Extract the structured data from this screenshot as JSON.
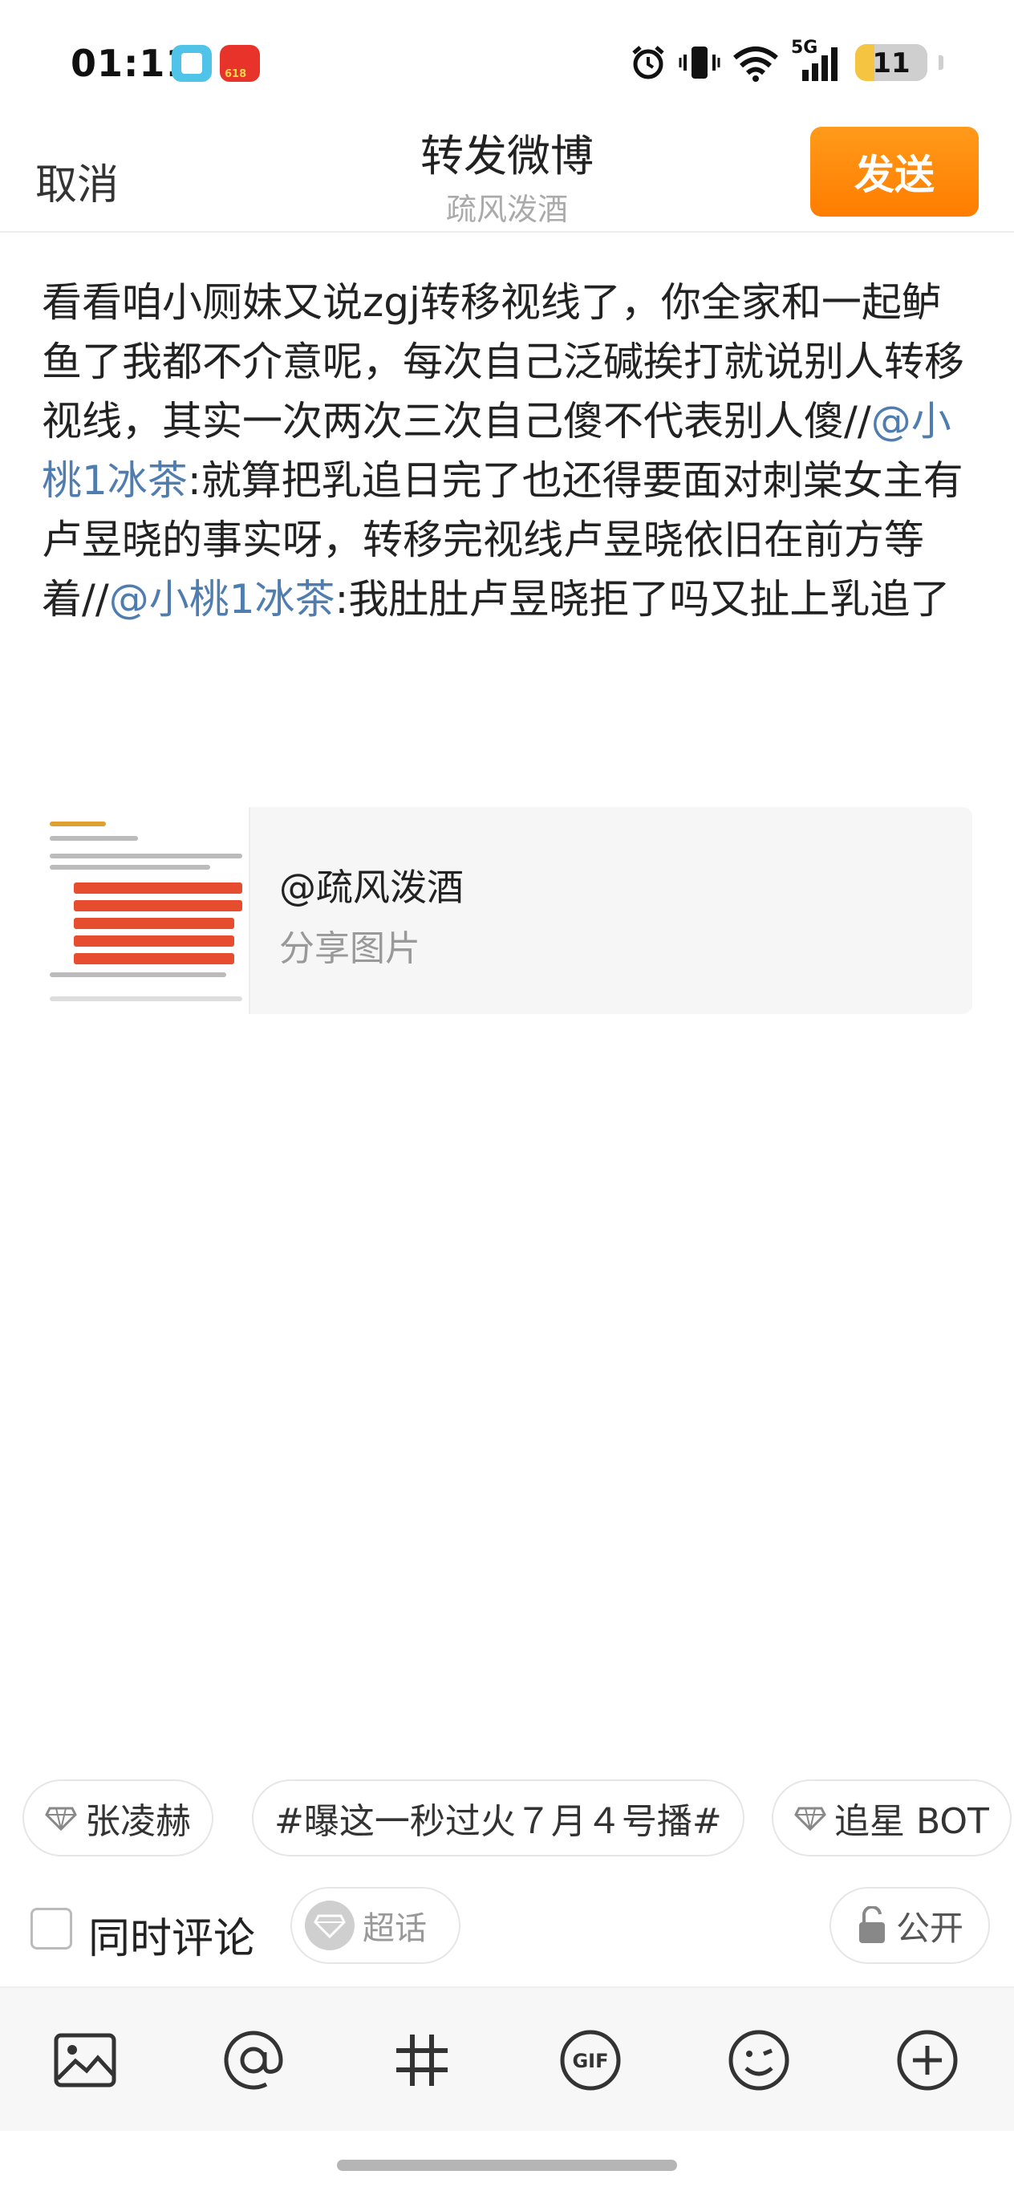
{
  "status_bar": {
    "time": "01:11",
    "network_label": "5G",
    "battery_level": "11"
  },
  "header": {
    "cancel_label": "取消",
    "title": "转发微博",
    "subtitle": "疏风泼酒",
    "send_label": "发送"
  },
  "compose": {
    "segments": [
      {
        "text": "看看咱小厕妹又说zgj转移视线了，你全家和一起鲈鱼了我都不介意呢，每次自己泛碱挨打就说别人转移视线，其实一次两次三次自己傻不代表别人傻//",
        "type": "text"
      },
      {
        "text": "@小桃1冰茶",
        "type": "mention"
      },
      {
        "text": ":就算把乳追日完了也还得要面对刺棠女主有卢昱晓的事实呀，转移完视线卢昱晓依旧在前方等着//",
        "type": "text"
      },
      {
        "text": "@小桃1冰茶",
        "type": "mention"
      },
      {
        "text": ":我肚肚卢昱晓拒了吗又扯上乳追了",
        "type": "text"
      }
    ]
  },
  "quote_card": {
    "author": "@疏风泼酒",
    "description": "分享图片"
  },
  "topic_chips": [
    {
      "label": "张凌赫",
      "icon": "super-topic-gem-icon"
    },
    {
      "label": "#曝这一秒过火７月４号播#",
      "icon": ""
    },
    {
      "label": "追星 BOT",
      "icon": "super-topic-gem-icon"
    }
  ],
  "options": {
    "comment_too_label": "同时评论",
    "comment_too_checked": false,
    "super_topic_label": "超话",
    "visibility_label": "公开"
  },
  "toolbar": {
    "buttons": [
      "image-icon",
      "at-icon",
      "hashtag-icon",
      "gif-icon",
      "emoji-icon",
      "plus-icon"
    ]
  },
  "colors": {
    "accent": "#ff8a00",
    "mention": "#507daf"
  }
}
